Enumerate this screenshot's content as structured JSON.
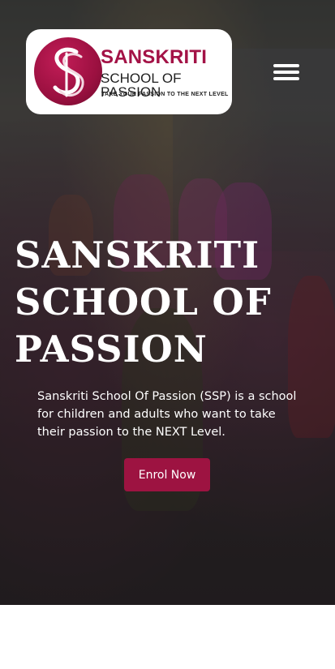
{
  "logo": {
    "title": "SANSKRITI",
    "subtitle": "SCHOOL OF PASSION",
    "tagline": "TAKE YOUR PASSION TO THE NEXT LEVEL",
    "mark_letters": "SP",
    "brand_color": "#a31246"
  },
  "menu": {
    "icon": "hamburger-icon"
  },
  "hero": {
    "title": "SANSKRITI SCHOOL OF PASSION",
    "description": "Sanskriti School Of Passion (SSP) is a school for children and adults who want to take their passion to the NEXT Level.",
    "cta_label": "Enrol Now",
    "cta_color": "#9d1341"
  }
}
